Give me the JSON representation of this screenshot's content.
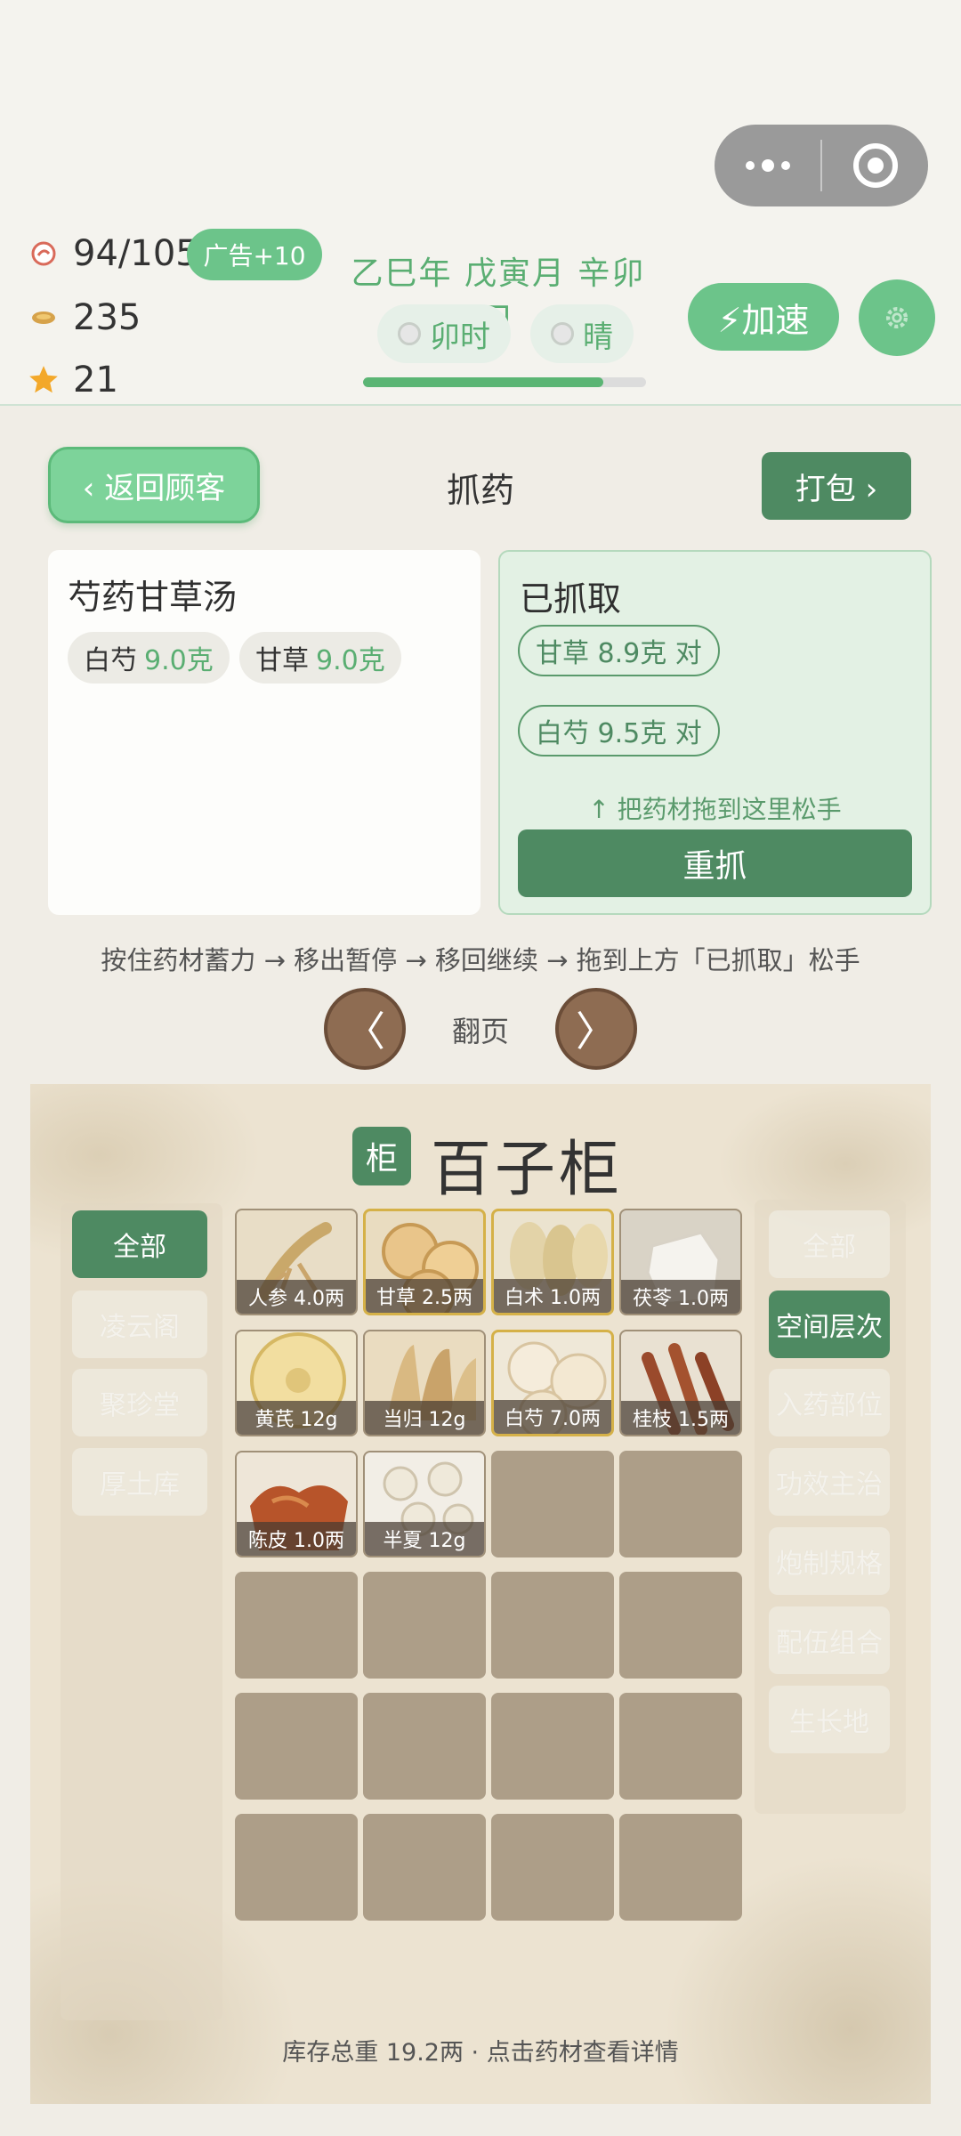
{
  "header": {
    "stamina": "94/105",
    "ad_button": "广告+10",
    "coins": "235",
    "stars": "21",
    "date": "乙巳年 戊寅月 辛卯日",
    "time_label": "卯时",
    "weather_label": "晴",
    "day_progress": 0.85,
    "speed_button": "⚡加速"
  },
  "toolbar": {
    "back_label": "‹ 返回顾客",
    "title": "抓药",
    "pack_label": "打包 ›"
  },
  "recipe": {
    "name": "芍药甘草汤",
    "ingredients": [
      {
        "name": "白芍",
        "amount": "9.0克"
      },
      {
        "name": "甘草",
        "amount": "9.0克"
      }
    ]
  },
  "taken": {
    "title": "已抓取",
    "items": [
      "甘草 8.9克 对",
      "白芍 9.5克 对"
    ],
    "drop_hint": "↑ 把药材拖到这里松手",
    "regrab_label": "重抓"
  },
  "instructions": "按住药材蓄力 → 移出暂停 → 移回继续 → 拖到上方「已抓取」松手",
  "pager": {
    "prev": "〈",
    "label": "翻页",
    "next": "〉"
  },
  "cabinet": {
    "badge": "柜",
    "title": "百子柜",
    "stores": [
      "全部",
      "凌云阁",
      "聚珍堂",
      "厚土库"
    ],
    "filters": [
      "全部",
      "空间层次",
      "入药部位",
      "功效主治",
      "炮制规格",
      "配伍组合",
      "生长地"
    ],
    "cells": [
      {
        "label": "人参 4.0两",
        "herb": "ginseng",
        "hl": false
      },
      {
        "label": "甘草 2.5两",
        "herb": "licorice",
        "hl": true
      },
      {
        "label": "白术 1.0两",
        "herb": "baizhu",
        "hl": true
      },
      {
        "label": "茯苓 1.0两",
        "herb": "fuling",
        "hl": false
      },
      {
        "label": "黄芪 12g",
        "herb": "astragalus",
        "hl": false
      },
      {
        "label": "当归 12g",
        "herb": "angelica",
        "hl": false
      },
      {
        "label": "白芍 7.0两",
        "herb": "baishao",
        "hl": true
      },
      {
        "label": "桂枝 1.5两",
        "herb": "cinnamon",
        "hl": false
      },
      {
        "label": "陈皮 1.0两",
        "herb": "chenpi",
        "hl": false
      },
      {
        "label": "半夏 12g",
        "herb": "banxia",
        "hl": false
      },
      {
        "label": "",
        "herb": "",
        "hl": false
      },
      {
        "label": "",
        "herb": "",
        "hl": false
      },
      {
        "label": "",
        "herb": "",
        "hl": false
      },
      {
        "label": "",
        "herb": "",
        "hl": false
      },
      {
        "label": "",
        "herb": "",
        "hl": false
      },
      {
        "label": "",
        "herb": "",
        "hl": false
      },
      {
        "label": "",
        "herb": "",
        "hl": false
      },
      {
        "label": "",
        "herb": "",
        "hl": false
      },
      {
        "label": "",
        "herb": "",
        "hl": false
      },
      {
        "label": "",
        "herb": "",
        "hl": false
      },
      {
        "label": "",
        "herb": "",
        "hl": false
      },
      {
        "label": "",
        "herb": "",
        "hl": false
      },
      {
        "label": "",
        "herb": "",
        "hl": false
      },
      {
        "label": "",
        "herb": "",
        "hl": false
      }
    ],
    "footer": "库存总重 19.2两 · 点击药材查看详情"
  },
  "icons": {
    "stamina": "stamina-icon",
    "coins": "coin-icon",
    "stars": "star-icon",
    "time": "clock-icon",
    "weather": "sun-icon",
    "settings": "gear-icon"
  },
  "colors": {
    "accent_green": "#6cc48a",
    "dark_green": "#4e8a62",
    "text_green": "#5aae72",
    "wood_brown": "#8e6c52",
    "drawer": "#ad9e88",
    "highlight_gold": "#d5b148"
  }
}
